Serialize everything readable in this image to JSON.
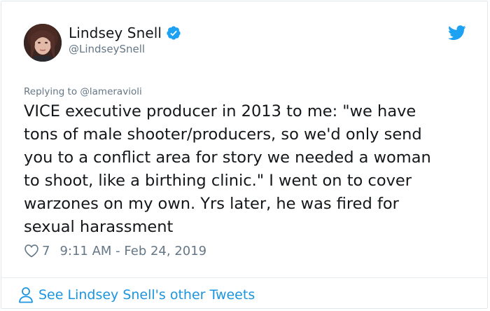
{
  "user": {
    "display_name": "Lindsey Snell",
    "handle": "@LindseySnell",
    "verified": true
  },
  "tweet": {
    "replying_prefix": "Replying to",
    "replying_to": "@lameravioli",
    "text": "VICE executive producer in 2013 to me: \"we have\ntons of male shooter/producers, so we'd only send\nyou to a conflict area for story we needed a woman\nto shoot, like a birthing clinic.\" I went on to cover\nwarzones on my own. Yrs later, he was fired for\nsexual harassment",
    "like_count": "7",
    "timestamp": "9:11 AM - Feb 24, 2019"
  },
  "footer": {
    "link_label": "See Lindsey Snell's other Tweets"
  },
  "icons": {
    "verified": "verified-badge-icon",
    "brand": "twitter-bird-icon",
    "like": "heart-icon",
    "profile": "person-icon"
  },
  "colors": {
    "twitter_blue": "#1da1f2",
    "link_blue": "#1b95e0",
    "secondary_text": "#657786",
    "primary_text": "#14171a"
  }
}
